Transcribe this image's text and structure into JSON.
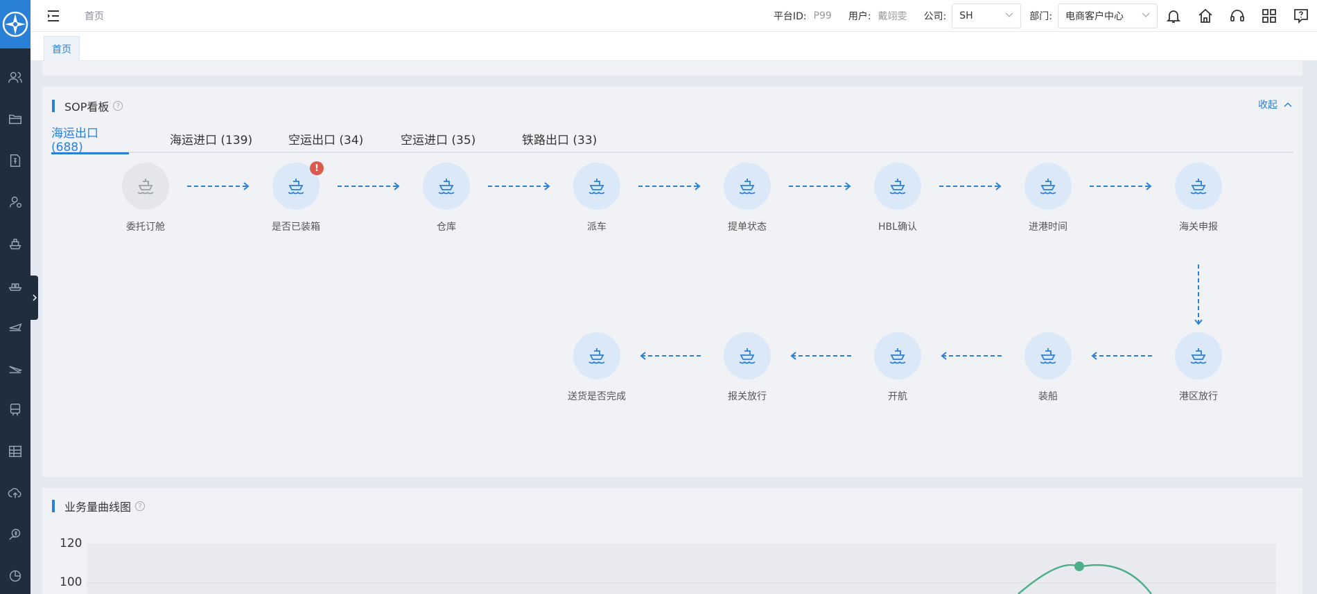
{
  "topbar": {
    "breadcrumb": "首页",
    "platform_label": "平台ID:",
    "platform_value": "P99",
    "user_label": "用户:",
    "user_value": "戴翊雯",
    "company_label": "公司:",
    "company_value": "SH",
    "dept_label": "部门:",
    "dept_value": "电商客户中心"
  },
  "page_tab": "首页",
  "sop": {
    "title": "SOP看板",
    "collapse_label": "收起",
    "tabs": [
      {
        "label": "海运出口 (688)"
      },
      {
        "label": "海运进口 (139)"
      },
      {
        "label": "空运出口 (34)"
      },
      {
        "label": "空运进口 (35)"
      },
      {
        "label": "铁路出口 (33)"
      }
    ],
    "row1": [
      {
        "label": "委托订舱",
        "state": "gray"
      },
      {
        "label": "是否已装箱",
        "badge": "!"
      },
      {
        "label": "仓库"
      },
      {
        "label": "派车"
      },
      {
        "label": "提单状态"
      },
      {
        "label": "HBL确认"
      },
      {
        "label": "进港时间"
      },
      {
        "label": "海关申报"
      }
    ],
    "row2": [
      {
        "label": "送货是否完成"
      },
      {
        "label": "报关放行"
      },
      {
        "label": "开航"
      },
      {
        "label": "装船"
      },
      {
        "label": "港区放行"
      }
    ]
  },
  "volume": {
    "title": "业务量曲线图",
    "y_ticks": [
      "120",
      "100"
    ]
  },
  "colors": {
    "accent": "#2a7fd6",
    "sidebar": "#1f2d3d",
    "badge": "#dc5a4b",
    "line": "#4caf8a"
  }
}
